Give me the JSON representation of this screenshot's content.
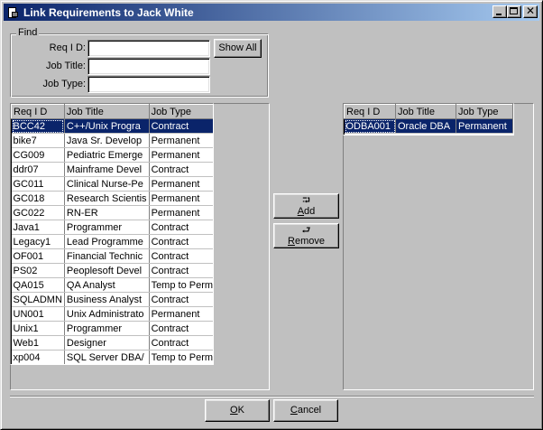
{
  "window": {
    "title": "Link Requirements to Jack White"
  },
  "find": {
    "legend": "Find",
    "req_id_label": "Req I D:",
    "job_title_label": "Job Title:",
    "job_type_label": "Job Type:",
    "req_id_value": "",
    "job_title_value": "",
    "job_type_value": "",
    "show_all_label": "Show All"
  },
  "left_grid": {
    "columns": [
      "Req I D",
      "Job Title",
      "Job Type"
    ],
    "rows": [
      [
        "BCC42",
        "C++/Unix Progra",
        "Contract"
      ],
      [
        "bike7",
        "Java Sr. Develop",
        "Permanent"
      ],
      [
        "CG009",
        "Pediatric Emerge",
        "Permanent"
      ],
      [
        "ddr07",
        "Mainframe Devel",
        "Contract"
      ],
      [
        "GC011",
        "Clinical Nurse-Pe",
        "Permanent"
      ],
      [
        "GC018",
        "Research Scientis",
        "Permanent"
      ],
      [
        "GC022",
        "RN-ER",
        "Permanent"
      ],
      [
        "Java1",
        "Programmer",
        "Contract"
      ],
      [
        "Legacy1",
        "Lead Programme",
        "Contract"
      ],
      [
        "OF001",
        "Financial Technic",
        "Contract"
      ],
      [
        "PS02",
        "Peoplesoft Devel",
        "Contract"
      ],
      [
        "QA015",
        "QA Analyst",
        "Temp to Perm"
      ],
      [
        "SQLADMN",
        " Business Analyst",
        "Contract"
      ],
      [
        "UN001",
        "Unix Administrato",
        "Permanent"
      ],
      [
        "Unix1",
        "Programmer",
        "Contract"
      ],
      [
        "Web1",
        "Designer",
        "Contract"
      ],
      [
        "xp004",
        "SQL Server DBA/",
        "Temp to Perm"
      ]
    ]
  },
  "right_grid": {
    "columns": [
      "Req I D",
      "Job Title",
      "Job Type"
    ],
    "rows": [
      [
        "ODBA001",
        "Oracle DBA",
        "Permanent"
      ]
    ]
  },
  "actions": {
    "add_arrow": "⮒",
    "add_label_mnemonic": "A",
    "add_label_rest": "dd",
    "remove_arrow": "⮐",
    "remove_label_mnemonic": "R",
    "remove_label_rest": "emove"
  },
  "footer": {
    "ok_mnemonic": "O",
    "ok_rest": "K",
    "cancel_mnemonic": "C",
    "cancel_rest": "ancel"
  },
  "colors": {
    "selection": "#0a246a",
    "face": "#c0c0c0"
  }
}
